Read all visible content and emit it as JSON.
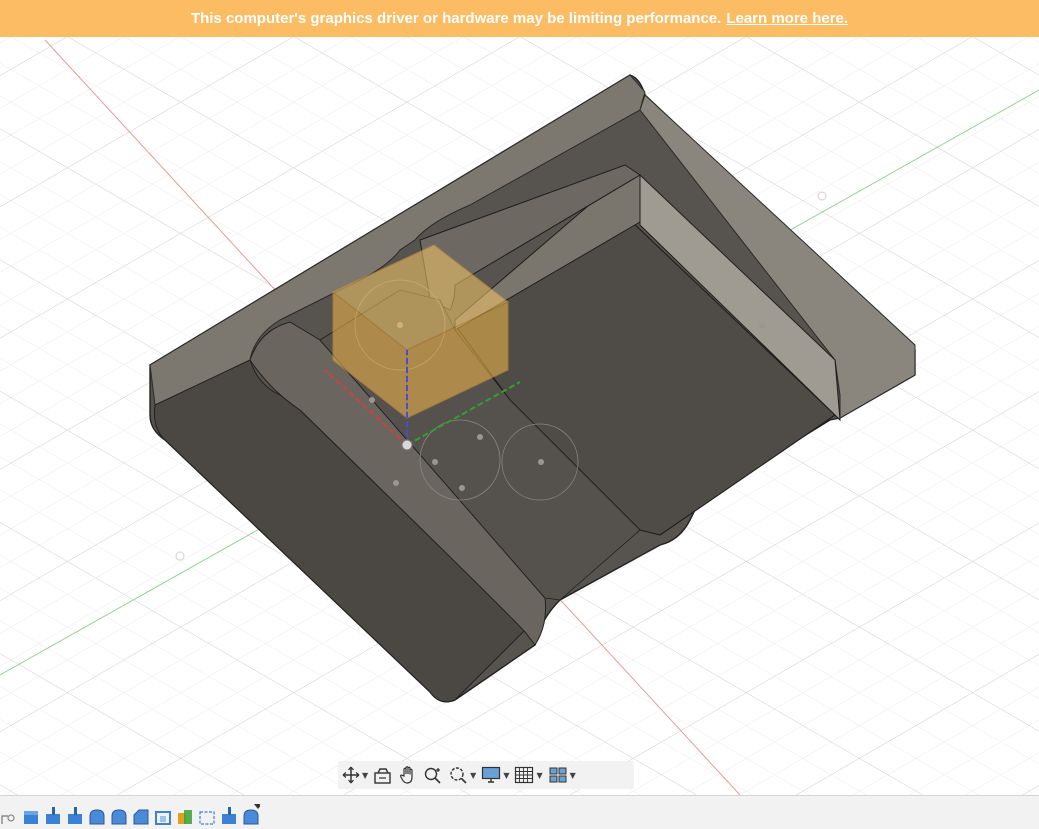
{
  "banner": {
    "message": "This computer's graphics driver or hardware may be limiting performance.",
    "link_text": "Learn more here.",
    "background_color": "#fcbc64"
  },
  "viewport": {
    "model_color": "#57544f",
    "axis_x_color": "#e06060",
    "axis_y_color": "#3aa832",
    "axis_z_color": "#4a4ad8",
    "origin_plane_color": "#f5b94a"
  },
  "navigation_toolbar": {
    "items": [
      {
        "icon": "orbit-icon",
        "has_dropdown": true
      },
      {
        "icon": "look-at-icon",
        "has_dropdown": false
      },
      {
        "icon": "pan-hand-icon",
        "has_dropdown": false
      },
      {
        "icon": "zoom-icon",
        "has_dropdown": false
      },
      {
        "icon": "zoom-window-icon",
        "has_dropdown": true
      },
      {
        "icon": "display-settings-icon",
        "has_dropdown": true
      },
      {
        "icon": "grid-settings-icon",
        "has_dropdown": true
      },
      {
        "icon": "viewports-icon",
        "has_dropdown": true
      }
    ]
  },
  "timeline": {
    "items": [
      "sketch-feature-icon",
      "extrude-feature-icon",
      "extrude-feature-icon",
      "extrude-feature-icon",
      "fillet-feature-icon",
      "fillet-feature-icon",
      "chamfer-feature-icon",
      "shell-feature-icon",
      "combine-feature-icon",
      "sketch-feature-icon",
      "extrude-feature-icon",
      "fillet-feature-icon"
    ]
  }
}
